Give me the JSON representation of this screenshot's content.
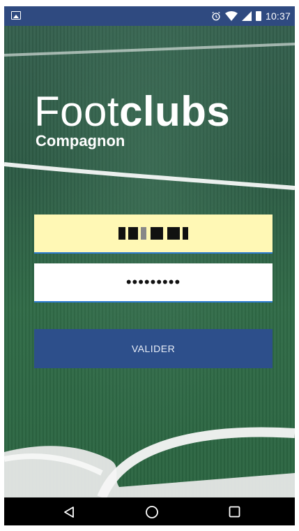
{
  "status_bar": {
    "time": "10:37"
  },
  "app": {
    "logo_light": "Foot",
    "logo_bold": "clubs",
    "logo_subtitle": "Compagnon"
  },
  "form": {
    "username_value": "",
    "password_value": "•••••••••",
    "submit_label": "VALIDER"
  },
  "colors": {
    "status_bar": "#2f4a80",
    "username_field": "#fff8b5",
    "button": "#2d4f8b",
    "input_underline": "#2c7bd1"
  }
}
